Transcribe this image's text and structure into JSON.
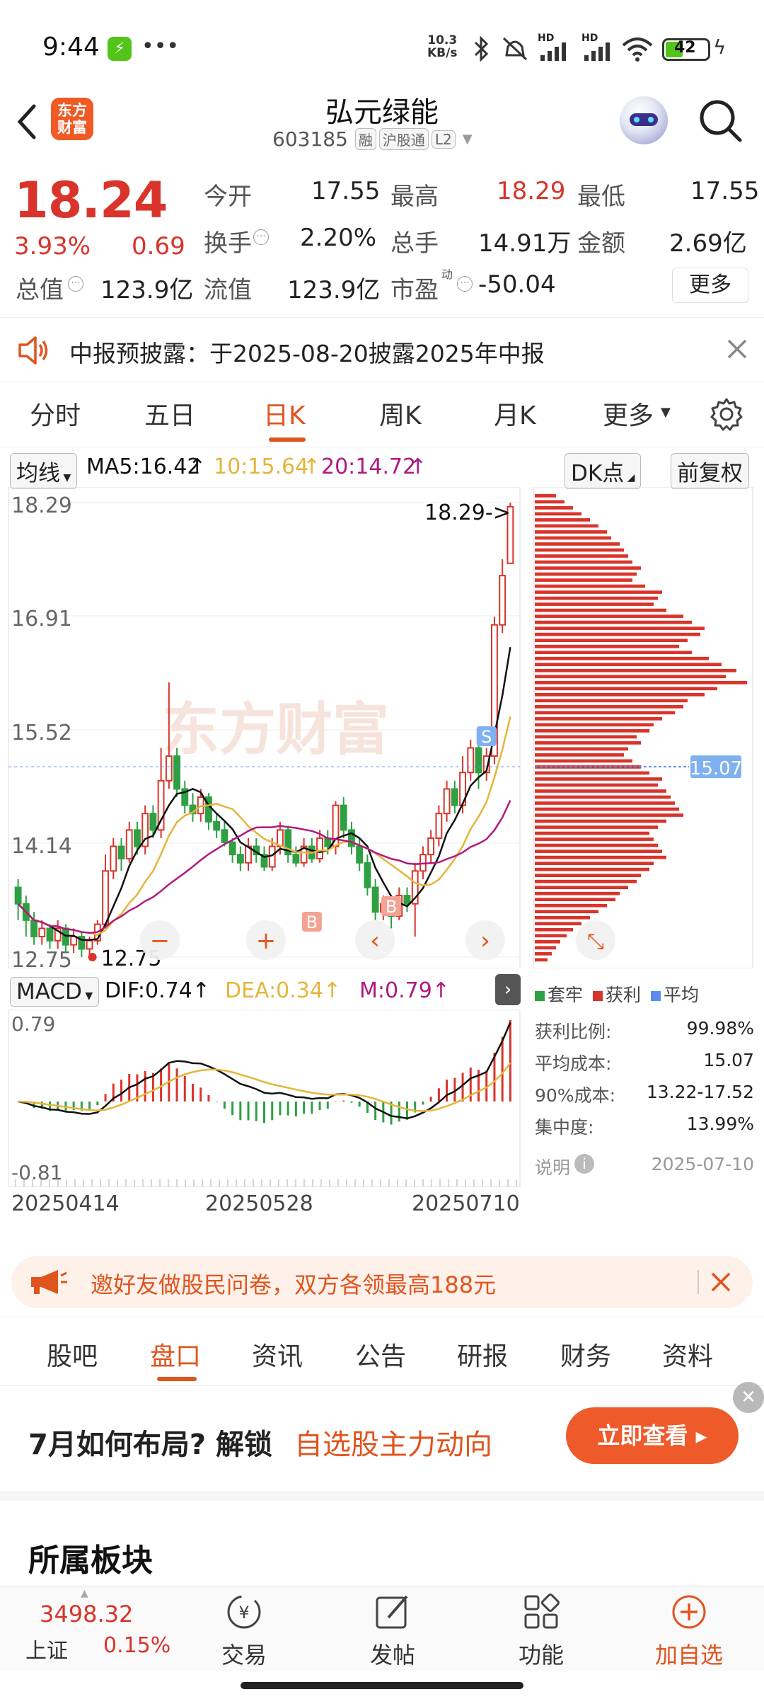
{
  "status": {
    "time": "9:44",
    "net_speed_top": "10.3",
    "net_speed_bottom": "KB/s",
    "battery": "42",
    "hd1": "HD",
    "hd2": "HD"
  },
  "header": {
    "title": "弘元绿能",
    "code": "603185",
    "badges": [
      "融",
      "沪股通",
      "L2"
    ],
    "logo_line1": "东方",
    "logo_line2": "财富"
  },
  "quote": {
    "price": "18.24",
    "change_pct": "3.93%",
    "change": "0.69",
    "open_label": "今开",
    "open": "17.55",
    "high_label": "最高",
    "high": "18.29",
    "low_label": "最低",
    "low": "17.55",
    "turnover_label": "换手",
    "turnover": "2.20%",
    "volume_label": "总手",
    "volume": "14.91万",
    "amount_label": "金额",
    "amount": "2.69亿",
    "mktcap_label": "总值",
    "mktcap": "123.9亿",
    "float_label": "流值",
    "float": "123.9亿",
    "pe_label": "市盈",
    "pe_sup": "动",
    "pe": "-50.04",
    "more": "更多"
  },
  "notice": {
    "text": "中报预披露：于2025-08-20披露2025年中报"
  },
  "tabs": [
    "分时",
    "五日",
    "日K",
    "周K",
    "月K",
    "更多"
  ],
  "chart_toolbar": {
    "ma_select": "均线",
    "ma5": "MA5:16.42",
    "ma10": "10:15.64",
    "ma20": "20:14.72",
    "dk": "DK点",
    "adjust": "前复权"
  },
  "colors": {
    "up": "#d9342b",
    "down": "#2ea043",
    "ma5": "#111111",
    "ma10": "#e5b53a",
    "ma20": "#b0197e",
    "accent": "#e0541d",
    "avg_blue": "#5b8def"
  },
  "chart_data": [
    {
      "type": "candlestick",
      "title": "日K",
      "ylim": [
        12.75,
        18.29
      ],
      "y_ticks": [
        "18.29",
        "16.91",
        "15.52",
        "14.14",
        "12.75"
      ],
      "x_labels": [
        "20250414",
        "20250528",
        "20250710"
      ],
      "annotations": {
        "high": "18.29->",
        "low": "12.75",
        "cost_line": "15.07",
        "buy": "B",
        "sell": "S"
      },
      "series": [
        {
          "name": "MA5",
          "value": 16.42
        },
        {
          "name": "MA10",
          "value": 15.64
        },
        {
          "name": "MA20",
          "value": 14.72
        }
      ],
      "candles": [
        [
          13.6,
          13.4,
          13.7,
          13.2
        ],
        [
          13.4,
          13.2,
          13.5,
          13.0
        ],
        [
          13.2,
          13.0,
          13.3,
          12.9
        ],
        [
          13.0,
          13.1,
          13.2,
          12.9
        ],
        [
          13.1,
          12.95,
          13.15,
          12.85
        ],
        [
          12.95,
          13.1,
          13.2,
          12.85
        ],
        [
          13.1,
          12.9,
          13.15,
          12.8
        ],
        [
          12.9,
          13.0,
          13.1,
          12.8
        ],
        [
          13.0,
          12.85,
          13.05,
          12.75
        ],
        [
          12.85,
          12.95,
          13.0,
          12.75
        ],
        [
          12.95,
          13.15,
          13.2,
          12.9
        ],
        [
          13.15,
          13.8,
          14.0,
          13.1
        ],
        [
          13.8,
          14.1,
          14.2,
          13.7
        ],
        [
          14.1,
          13.95,
          14.2,
          13.8
        ],
        [
          13.95,
          14.3,
          14.4,
          13.9
        ],
        [
          14.3,
          14.1,
          14.4,
          14.0
        ],
        [
          14.1,
          14.5,
          14.6,
          14.0
        ],
        [
          14.5,
          14.3,
          14.6,
          14.2
        ],
        [
          14.3,
          14.9,
          15.3,
          14.2
        ],
        [
          14.9,
          15.2,
          16.1,
          14.8
        ],
        [
          15.2,
          14.8,
          15.3,
          14.7
        ],
        [
          14.8,
          14.6,
          14.9,
          14.5
        ],
        [
          14.6,
          14.5,
          14.75,
          14.4
        ],
        [
          14.5,
          14.7,
          14.8,
          14.4
        ],
        [
          14.7,
          14.4,
          14.75,
          14.3
        ],
        [
          14.4,
          14.3,
          14.5,
          14.2
        ],
        [
          14.3,
          14.15,
          14.4,
          14.1
        ],
        [
          14.15,
          14.0,
          14.2,
          13.9
        ],
        [
          14.0,
          13.9,
          14.1,
          13.8
        ],
        [
          13.9,
          14.1,
          14.2,
          13.8
        ],
        [
          14.1,
          14.0,
          14.2,
          13.9
        ],
        [
          14.0,
          13.85,
          14.1,
          13.8
        ],
        [
          13.85,
          14.1,
          14.2,
          13.8
        ],
        [
          14.1,
          14.3,
          14.4,
          14.0
        ],
        [
          14.3,
          14.0,
          14.35,
          13.9
        ],
        [
          14.0,
          13.9,
          14.1,
          13.85
        ],
        [
          13.9,
          14.1,
          14.2,
          13.85
        ],
        [
          14.1,
          13.95,
          14.2,
          13.9
        ],
        [
          13.95,
          14.2,
          14.3,
          13.9
        ],
        [
          14.2,
          14.1,
          14.3,
          14.0
        ],
        [
          14.1,
          14.6,
          14.65,
          14.0
        ],
        [
          14.6,
          14.3,
          14.7,
          14.2
        ],
        [
          14.3,
          14.1,
          14.4,
          14.0
        ],
        [
          14.1,
          13.9,
          14.2,
          13.8
        ],
        [
          13.9,
          13.6,
          14.0,
          13.5
        ],
        [
          13.6,
          13.3,
          13.7,
          13.2
        ],
        [
          13.3,
          13.4,
          13.5,
          13.2
        ],
        [
          13.4,
          13.25,
          13.5,
          13.1
        ],
        [
          13.25,
          13.5,
          13.6,
          13.2
        ],
        [
          13.5,
          13.4,
          13.6,
          13.3
        ],
        [
          13.4,
          13.8,
          13.9,
          13.0
        ],
        [
          13.8,
          14.0,
          14.1,
          13.7
        ],
        [
          14.0,
          14.2,
          14.3,
          13.9
        ],
        [
          14.2,
          14.5,
          14.6,
          14.1
        ],
        [
          14.5,
          14.8,
          14.9,
          14.4
        ],
        [
          14.8,
          14.6,
          14.9,
          14.5
        ],
        [
          14.6,
          15.0,
          15.2,
          14.5
        ],
        [
          15.0,
          15.3,
          15.4,
          14.9
        ],
        [
          15.3,
          15.0,
          15.4,
          14.8
        ],
        [
          15.0,
          15.2,
          15.3,
          14.9
        ],
        [
          15.2,
          16.8,
          16.9,
          15.1
        ],
        [
          16.8,
          17.4,
          17.6,
          16.7
        ],
        [
          17.55,
          18.24,
          18.29,
          17.55
        ]
      ]
    },
    {
      "type": "bar",
      "title": "MACD",
      "ylim": [
        -0.81,
        0.79
      ],
      "y_ticks": [
        "0.79",
        "-0.81"
      ],
      "series": [
        {
          "name": "DIF",
          "value": 0.74
        },
        {
          "name": "DEA",
          "value": 0.34
        },
        {
          "name": "M",
          "value": 0.79
        }
      ]
    },
    {
      "type": "bar",
      "title": "筹码分布",
      "legend": [
        "套牢",
        "获利",
        "平均"
      ],
      "values": [
        0.1,
        0.14,
        0.18,
        0.22,
        0.26,
        0.3,
        0.34,
        0.36,
        0.4,
        0.42,
        0.44,
        0.46,
        0.5,
        0.48,
        0.46,
        0.52,
        0.6,
        0.58,
        0.56,
        0.62,
        0.7,
        0.74,
        0.8,
        0.78,
        0.72,
        0.68,
        0.74,
        0.82,
        0.88,
        0.95,
        0.9,
        1.0,
        0.86,
        0.8,
        0.72,
        0.7,
        0.66,
        0.6,
        0.56,
        0.54,
        0.48,
        0.5,
        0.44,
        0.42,
        0.46,
        0.5,
        0.54,
        0.6,
        0.58,
        0.62,
        0.64,
        0.66,
        0.68,
        0.7,
        0.62,
        0.58,
        0.54,
        0.56,
        0.58,
        0.6,
        0.62,
        0.56,
        0.54,
        0.5,
        0.48,
        0.44,
        0.4,
        0.38,
        0.34,
        0.3,
        0.26,
        0.22,
        0.18,
        0.15,
        0.12,
        0.1,
        0.08,
        0.06
      ]
    }
  ],
  "chip_stats": {
    "profit_ratio_label": "获利比例:",
    "profit_ratio": "99.98%",
    "avg_cost_label": "平均成本:",
    "avg_cost": "15.07",
    "cost90_label": "90%成本:",
    "cost90": "13.22-17.52",
    "concentration_label": "集中度:",
    "concentration": "13.99%",
    "note_label": "说明",
    "date": "2025-07-10"
  },
  "promo": {
    "text": "邀好友做股民问卷，双方各领最高188元"
  },
  "sub_tabs": [
    "股吧",
    "盘口",
    "资讯",
    "公告",
    "研报",
    "财务",
    "资料"
  ],
  "banner": {
    "prefix": "7月如何布局? 解锁",
    "highlight": "自选股主力动向",
    "button": "立即查看"
  },
  "section_title": "所属板块",
  "bottom_bar": {
    "index_value": "3498.32",
    "index_name": "上证",
    "index_change": "0.15%",
    "items": [
      "交易",
      "发帖",
      "功能",
      "加自选"
    ]
  }
}
